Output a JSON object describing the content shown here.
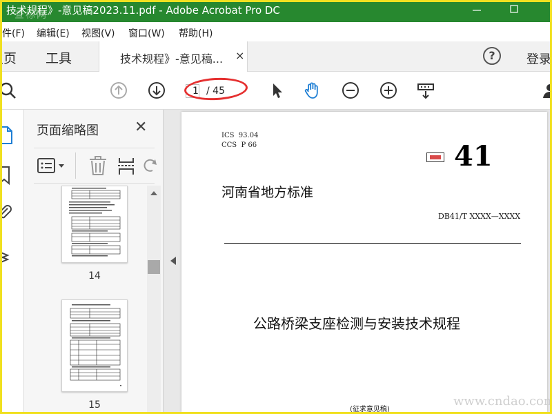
{
  "window": {
    "title": "技术规程》-意见稿2023.11.pdf - Adobe Acrobat Pro DC",
    "watermark_top": "查标网"
  },
  "menu": [
    "件(F)",
    "编辑(E)",
    "视图(V)",
    "窗口(W)",
    "帮助(H)"
  ],
  "tabs": {
    "home": "主页",
    "tools": "工具",
    "document": "技术规程》-意见稿...",
    "close": "×",
    "help": "?",
    "login": "登录"
  },
  "toolbar": {
    "current_page": "1",
    "total_pages": "/ 45",
    "icons": [
      "search-icon",
      "previous-page-icon",
      "next-page-icon",
      "select-tool-icon",
      "hand-tool-icon",
      "zoom-out-icon",
      "zoom-in-icon",
      "page-display-icon",
      "user-icon"
    ]
  },
  "thumbnails_panel": {
    "title": "页面缩略图",
    "close": "✕",
    "pages": [
      {
        "number": "14"
      },
      {
        "number": "15"
      }
    ]
  },
  "document": {
    "ics_line": "ICS  93.04",
    "ccs_line": "CCS  P 66",
    "big_number": "41",
    "agency": "河南省地方标准",
    "code": "DB41/T XXXX—XXXX",
    "title": "公路桥梁支座检测与安装技术规程",
    "draft_note": "(征求意见稿)"
  },
  "watermark_bottom": "www.cndao.com",
  "colors": {
    "titlebar": "#27882f",
    "border": "#f0e020",
    "annotation_circle": "#e53030",
    "active_tool": "#1f7fd4"
  }
}
